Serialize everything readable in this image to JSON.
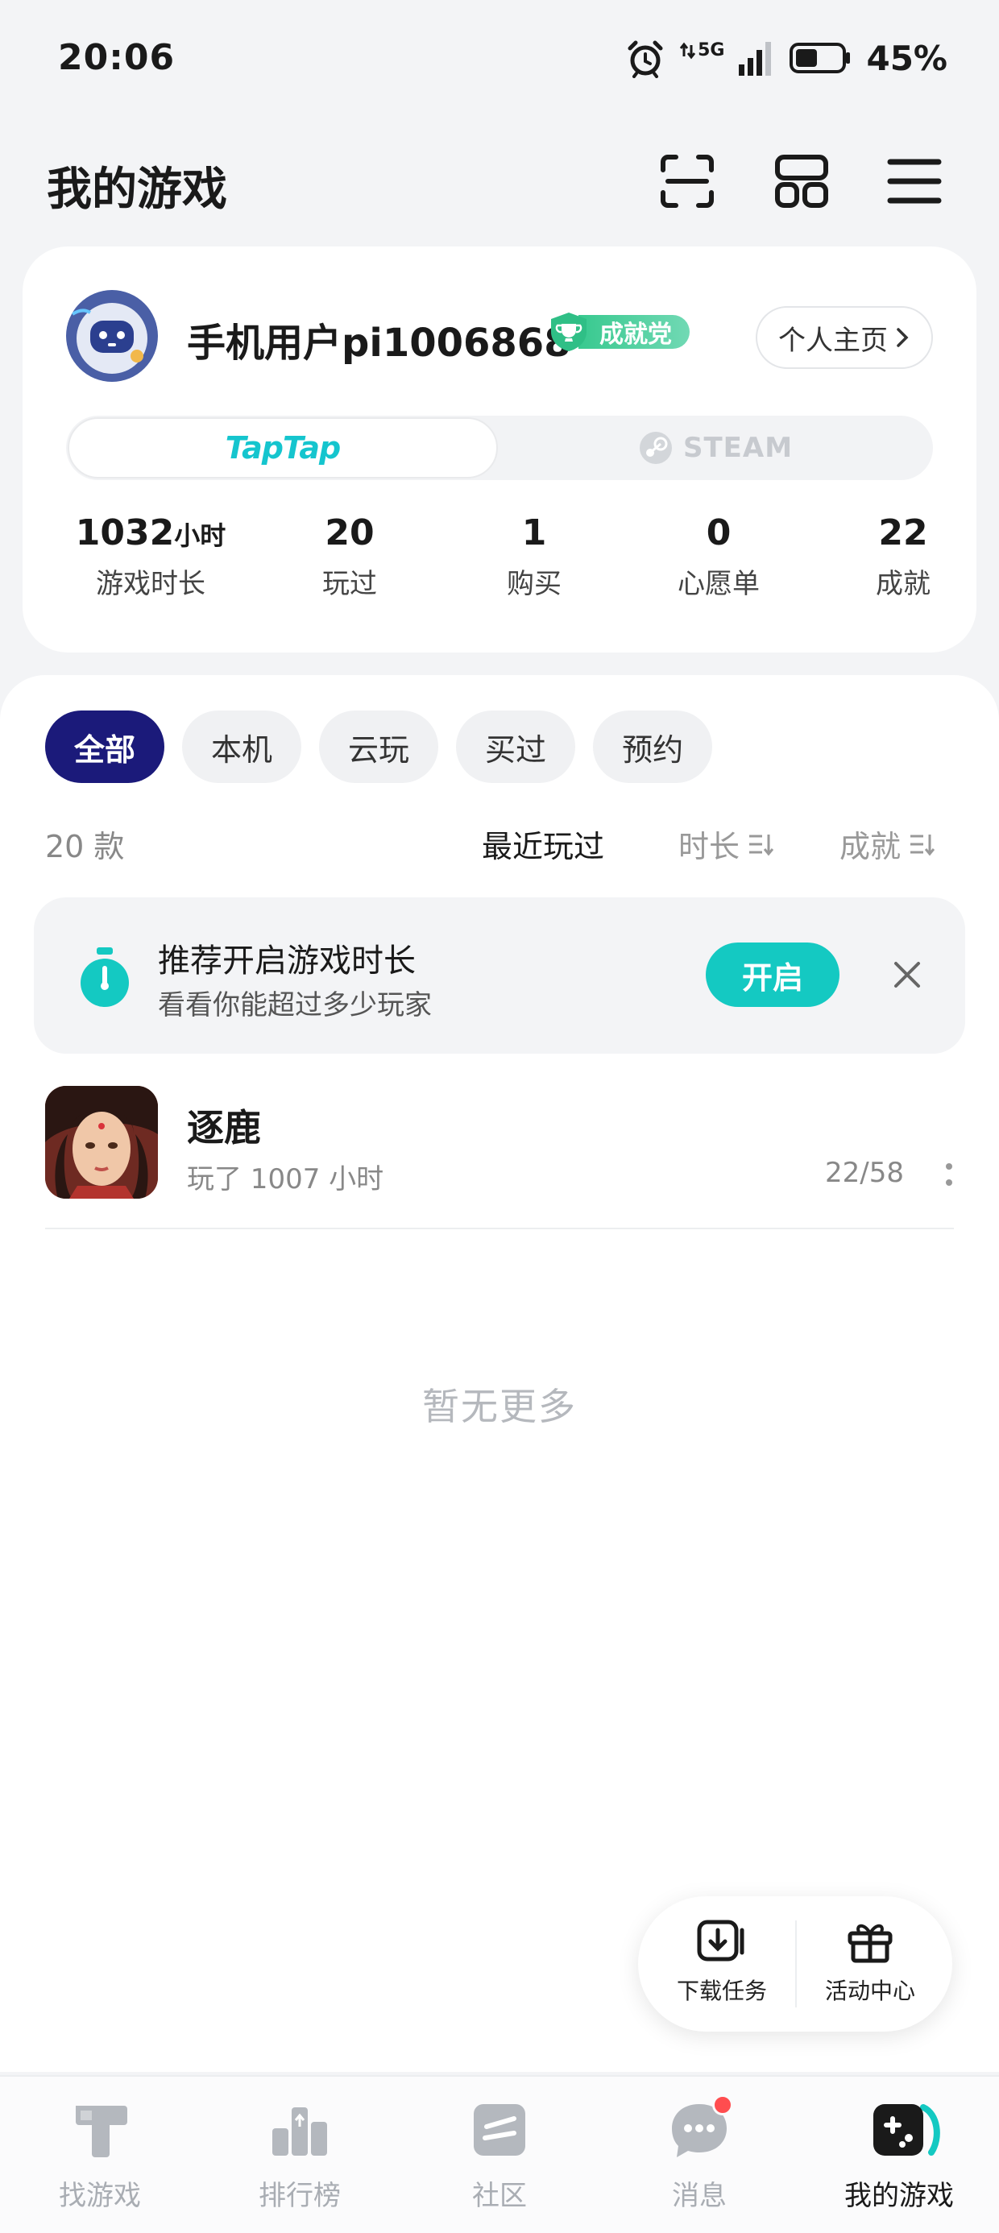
{
  "status_bar": {
    "time": "20:06",
    "network": "5G",
    "battery_pct": "45%",
    "battery_level": 0.45,
    "icons": [
      "alarm-icon",
      "network-5g-icon",
      "signal-icon",
      "battery-icon"
    ]
  },
  "header": {
    "title": "我的游戏",
    "actions": [
      "scan-icon",
      "grid-icon",
      "menu-icon"
    ]
  },
  "profile": {
    "username": "手机用户pi1006868",
    "badge": "成就党",
    "profile_link": "个人主页",
    "platforms": {
      "taptap": "TapTap",
      "steam": "STEAM",
      "selected": "taptap"
    },
    "stats": [
      {
        "value": "1032",
        "unit": "小时",
        "label": "游戏时长"
      },
      {
        "value": "20",
        "unit": "",
        "label": "玩过"
      },
      {
        "value": "1",
        "unit": "",
        "label": "购买"
      },
      {
        "value": "0",
        "unit": "",
        "label": "心愿单"
      },
      {
        "value": "22",
        "unit": "",
        "label": "成就"
      }
    ]
  },
  "filters": {
    "chips": [
      "全部",
      "本机",
      "云玩",
      "买过",
      "预约"
    ],
    "active": "全部",
    "count": "20 款",
    "sort": {
      "recent": "最近玩过",
      "duration": "时长",
      "achievements": "成就"
    }
  },
  "banner": {
    "title": "推荐开启游戏时长",
    "subtitle": "看看你能超过多少玩家",
    "button": "开启"
  },
  "games": [
    {
      "name": "逐鹿",
      "played": "玩了 1007 小时",
      "achievements": "22/58"
    }
  ],
  "empty_text": "暂无更多",
  "floating": {
    "download": "下载任务",
    "events": "活动中心"
  },
  "nav": {
    "items": [
      "找游戏",
      "排行榜",
      "社区",
      "消息",
      "我的游戏"
    ],
    "active": "我的游戏"
  },
  "colors": {
    "accent": "#14c9c2",
    "chip_active": "#1b1a7a",
    "badge": "#38c98f",
    "notify_dot": "#ff4d4f"
  }
}
